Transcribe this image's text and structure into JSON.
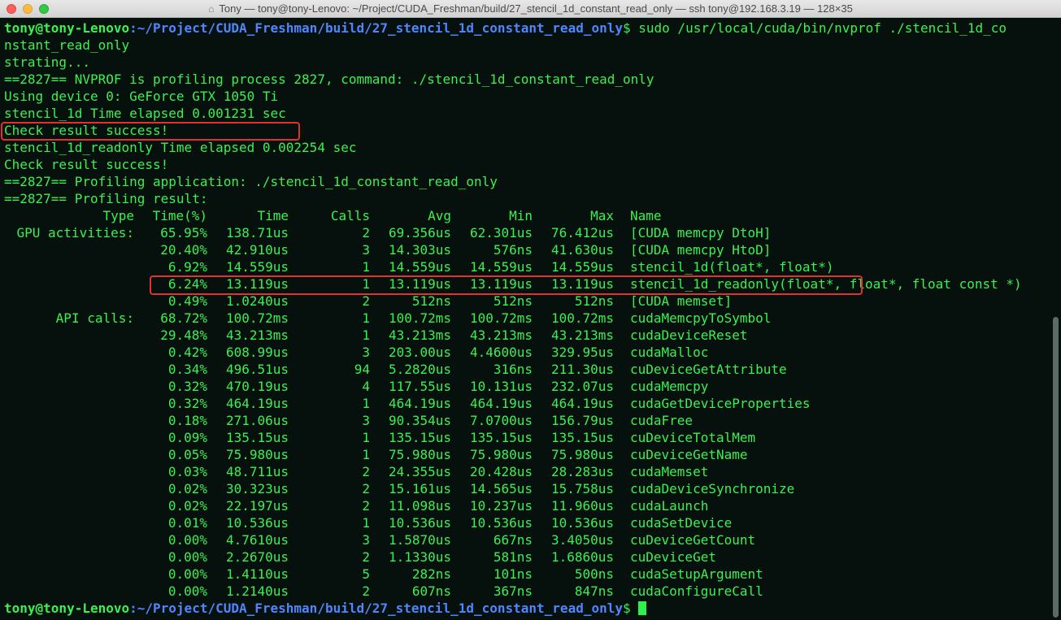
{
  "window": {
    "title": "Tony — tony@tony-Lenovo: ~/Project/CUDA_Freshman/build/27_stencil_1d_constant_read_only — ssh tony@192.168.3.19 — 128×35",
    "home_icon": "home-icon"
  },
  "prompt": {
    "user_host": "tony@tony-Lenovo",
    "path": ":~/Project/CUDA_Freshman/build/27_stencil_1d_constant_read_only",
    "symbol": "$ "
  },
  "command": {
    "text": "sudo /usr/local/cuda/bin/nvprof ./stencil_1d_co",
    "wrap": "nstant_read_only"
  },
  "output": [
    "strating...",
    "==2827== NVPROF is profiling process 2827, command: ./stencil_1d_constant_read_only",
    "Using device 0: GeForce GTX 1050 Ti",
    "stencil_1d Time elapsed 0.001231 sec",
    "Check result success!",
    "stencil_1d_readonly Time elapsed 0.002254 sec",
    "Check result success!",
    "==2827== Profiling application: ./stencil_1d_constant_read_only",
    "==2827== Profiling result:"
  ],
  "table": {
    "headers": [
      "Type",
      "Time(%)",
      "Time",
      "Calls",
      "Avg",
      "Min",
      "Max",
      "Name"
    ],
    "rows": [
      [
        "GPU activities:",
        "65.95%",
        "138.71us",
        "2",
        "69.356us",
        "62.301us",
        "76.412us",
        "[CUDA memcpy DtoH]"
      ],
      [
        "",
        "20.40%",
        "42.910us",
        "3",
        "14.303us",
        "576ns",
        "41.630us",
        "[CUDA memcpy HtoD]"
      ],
      [
        "",
        "6.92%",
        "14.559us",
        "1",
        "14.559us",
        "14.559us",
        "14.559us",
        "stencil_1d(float*, float*)"
      ],
      [
        "",
        "6.24%",
        "13.119us",
        "1",
        "13.119us",
        "13.119us",
        "13.119us",
        "stencil_1d_readonly(float*, float*, float const *)"
      ],
      [
        "",
        "0.49%",
        "1.0240us",
        "2",
        "512ns",
        "512ns",
        "512ns",
        "[CUDA memset]"
      ],
      [
        "API calls:",
        "68.72%",
        "100.72ms",
        "1",
        "100.72ms",
        "100.72ms",
        "100.72ms",
        "cudaMemcpyToSymbol"
      ],
      [
        "",
        "29.48%",
        "43.213ms",
        "1",
        "43.213ms",
        "43.213ms",
        "43.213ms",
        "cudaDeviceReset"
      ],
      [
        "",
        "0.42%",
        "608.99us",
        "3",
        "203.00us",
        "4.4600us",
        "329.95us",
        "cudaMalloc"
      ],
      [
        "",
        "0.34%",
        "496.51us",
        "94",
        "5.2820us",
        "316ns",
        "211.30us",
        "cuDeviceGetAttribute"
      ],
      [
        "",
        "0.32%",
        "470.19us",
        "4",
        "117.55us",
        "10.131us",
        "232.07us",
        "cudaMemcpy"
      ],
      [
        "",
        "0.32%",
        "464.19us",
        "1",
        "464.19us",
        "464.19us",
        "464.19us",
        "cudaGetDeviceProperties"
      ],
      [
        "",
        "0.18%",
        "271.06us",
        "3",
        "90.354us",
        "7.0700us",
        "156.79us",
        "cudaFree"
      ],
      [
        "",
        "0.09%",
        "135.15us",
        "1",
        "135.15us",
        "135.15us",
        "135.15us",
        "cuDeviceTotalMem"
      ],
      [
        "",
        "0.05%",
        "75.980us",
        "1",
        "75.980us",
        "75.980us",
        "75.980us",
        "cuDeviceGetName"
      ],
      [
        "",
        "0.03%",
        "48.711us",
        "2",
        "24.355us",
        "20.428us",
        "28.283us",
        "cudaMemset"
      ],
      [
        "",
        "0.02%",
        "30.323us",
        "2",
        "15.161us",
        "14.565us",
        "15.758us",
        "cudaDeviceSynchronize"
      ],
      [
        "",
        "0.02%",
        "22.197us",
        "2",
        "11.098us",
        "10.237us",
        "11.960us",
        "cudaLaunch"
      ],
      [
        "",
        "0.01%",
        "10.536us",
        "1",
        "10.536us",
        "10.536us",
        "10.536us",
        "cudaSetDevice"
      ],
      [
        "",
        "0.00%",
        "4.7610us",
        "3",
        "1.5870us",
        "667ns",
        "3.4050us",
        "cuDeviceGetCount"
      ],
      [
        "",
        "0.00%",
        "2.2670us",
        "2",
        "1.1330us",
        "581ns",
        "1.6860us",
        "cuDeviceGet"
      ],
      [
        "",
        "0.00%",
        "1.4110us",
        "5",
        "282ns",
        "101ns",
        "500ns",
        "cudaSetupArgument"
      ],
      [
        "",
        "0.00%",
        "1.2140us",
        "2",
        "607ns",
        "367ns",
        "847ns",
        "cudaConfigureCall"
      ]
    ]
  },
  "colors": {
    "background": "#06100c",
    "text": "#3cf052",
    "path": "#4f86ff",
    "highlight_box": "#e0322f"
  }
}
